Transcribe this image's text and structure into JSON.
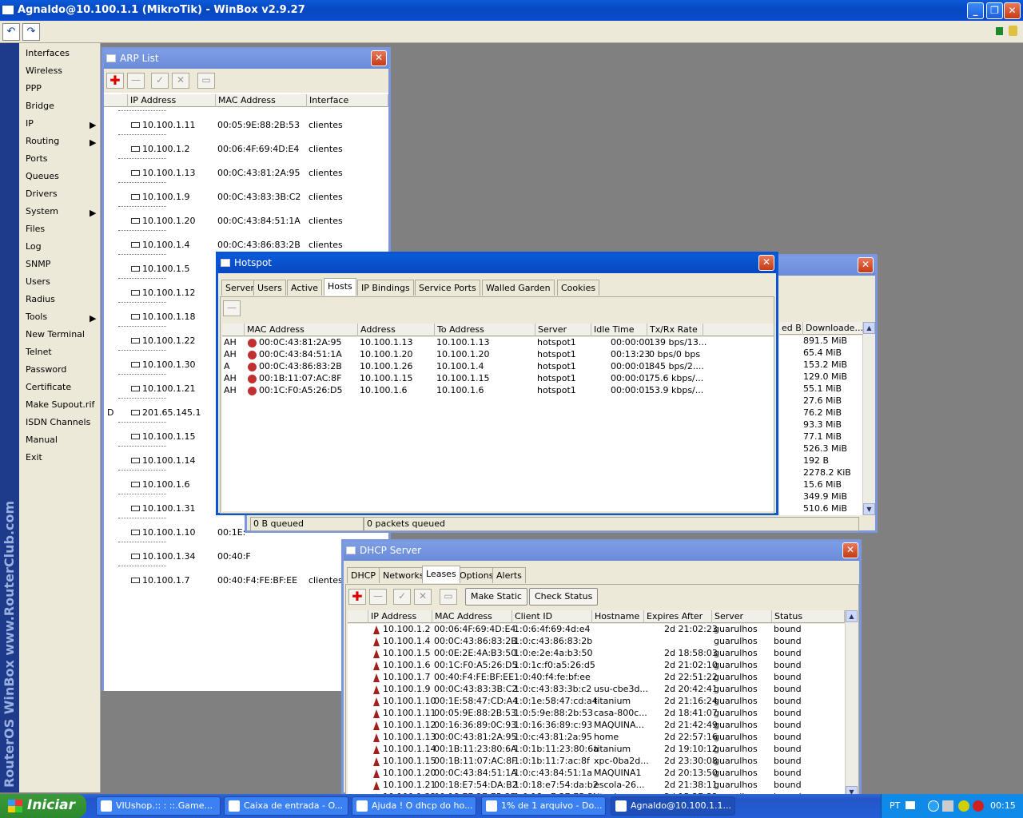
{
  "window_title": "Agnaldo@10.100.1.1 (MikroTik) - WinBox v2.9.27",
  "brand": "RouterOS WinBox  www.RouterClub.com",
  "menu": [
    {
      "label": "Interfaces",
      "sub": false
    },
    {
      "label": "Wireless",
      "sub": false
    },
    {
      "label": "PPP",
      "sub": false
    },
    {
      "label": "Bridge",
      "sub": false
    },
    {
      "label": "IP",
      "sub": true
    },
    {
      "label": "Routing",
      "sub": true
    },
    {
      "label": "Ports",
      "sub": false
    },
    {
      "label": "Queues",
      "sub": false
    },
    {
      "label": "Drivers",
      "sub": false
    },
    {
      "label": "System",
      "sub": true
    },
    {
      "label": "Files",
      "sub": false
    },
    {
      "label": "Log",
      "sub": false
    },
    {
      "label": "SNMP",
      "sub": false
    },
    {
      "label": "Users",
      "sub": false
    },
    {
      "label": "Radius",
      "sub": false
    },
    {
      "label": "Tools",
      "sub": true
    },
    {
      "label": "New Terminal",
      "sub": false
    },
    {
      "label": "Telnet",
      "sub": false
    },
    {
      "label": "Password",
      "sub": false
    },
    {
      "label": "Certificate",
      "sub": false
    },
    {
      "label": "Make Supout.rif",
      "sub": false
    },
    {
      "label": "ISDN Channels",
      "sub": false
    },
    {
      "label": "Manual",
      "sub": false
    },
    {
      "label": "Exit",
      "sub": false
    }
  ],
  "arp": {
    "title": "ARP List",
    "columns": [
      "IP Address",
      "MAC Address",
      "Interface"
    ],
    "rows": [
      {
        "flag": "",
        "ip": "10.100.1.11",
        "mac": "00:05:9E:88:2B:53",
        "iface": "clientes"
      },
      {
        "flag": "",
        "ip": "10.100.1.2",
        "mac": "00:06:4F:69:4D:E4",
        "iface": "clientes"
      },
      {
        "flag": "",
        "ip": "10.100.1.13",
        "mac": "00:0C:43:81:2A:95",
        "iface": "clientes"
      },
      {
        "flag": "",
        "ip": "10.100.1.9",
        "mac": "00:0C:43:83:3B:C2",
        "iface": "clientes"
      },
      {
        "flag": "",
        "ip": "10.100.1.20",
        "mac": "00:0C:43:84:51:1A",
        "iface": "clientes"
      },
      {
        "flag": "",
        "ip": "10.100.1.4",
        "mac": "00:0C:43:86:83:2B",
        "iface": "clientes"
      },
      {
        "flag": "",
        "ip": "10.100.1.5",
        "mac": "",
        "iface": ""
      },
      {
        "flag": "",
        "ip": "10.100.1.12",
        "mac": "",
        "iface": ""
      },
      {
        "flag": "",
        "ip": "10.100.1.18",
        "mac": "",
        "iface": ""
      },
      {
        "flag": "",
        "ip": "10.100.1.22",
        "mac": "",
        "iface": ""
      },
      {
        "flag": "",
        "ip": "10.100.1.30",
        "mac": "",
        "iface": ""
      },
      {
        "flag": "",
        "ip": "10.100.1.21",
        "mac": "",
        "iface": ""
      },
      {
        "flag": "D",
        "ip": "201.65.145.1",
        "mac": "",
        "iface": ""
      },
      {
        "flag": "",
        "ip": "10.100.1.15",
        "mac": "",
        "iface": ""
      },
      {
        "flag": "",
        "ip": "10.100.1.14",
        "mac": "",
        "iface": ""
      },
      {
        "flag": "",
        "ip": "10.100.1.6",
        "mac": "",
        "iface": ""
      },
      {
        "flag": "",
        "ip": "10.100.1.31",
        "mac": "",
        "iface": ""
      },
      {
        "flag": "",
        "ip": "10.100.1.10",
        "mac": "00:1E:",
        "iface": ""
      },
      {
        "flag": "",
        "ip": "10.100.1.34",
        "mac": "00:40:F",
        "iface": ""
      },
      {
        "flag": "",
        "ip": "10.100.1.7",
        "mac": "00:40:F4:FE:BF:EE",
        "iface": "clientes"
      }
    ]
  },
  "queue_win": {
    "columns": [
      "ed B...",
      "Downloade..."
    ],
    "values": [
      "891.5 MiB",
      "65.4 MiB",
      "153.2 MiB",
      "129.0 MiB",
      "55.1 MiB",
      "27.6 MiB",
      "76.2 MiB",
      "93.3 MiB",
      "77.1 MiB",
      "526.3 MiB",
      "192 B",
      "2278.2 KiB",
      "15.6 MiB",
      "349.9 MiB",
      "510.6 MiB"
    ],
    "status1": "0 B queued",
    "status2": "0 packets queued"
  },
  "hotspot": {
    "title": "Hotspot",
    "tabs": [
      "Servers",
      "Users",
      "Active",
      "Hosts",
      "IP Bindings",
      "Service Ports",
      "Walled Garden",
      "Cookies"
    ],
    "active_tab": "Hosts",
    "columns": [
      "MAC Address",
      "Address",
      "To Address",
      "Server",
      "Idle Time",
      "Tx/Rx Rate"
    ],
    "rows": [
      {
        "flag": "AH",
        "mac": "00:0C:43:81:2A:95",
        "addr": "10.100.1.13",
        "to": "10.100.1.13",
        "server": "hotspot1",
        "idle": "00:00:00",
        "rate": "139 bps/13..."
      },
      {
        "flag": "AH",
        "mac": "00:0C:43:84:51:1A",
        "addr": "10.100.1.20",
        "to": "10.100.1.20",
        "server": "hotspot1",
        "idle": "00:13:23",
        "rate": "0 bps/0 bps"
      },
      {
        "flag": "A",
        "mac": "00:0C:43:86:83:2B",
        "addr": "10.100.1.26",
        "to": "10.100.1.4",
        "server": "hotspot1",
        "idle": "00:00:01",
        "rate": "845 bps/2...."
      },
      {
        "flag": "AH",
        "mac": "00:1B:11:07:AC:8F",
        "addr": "10.100.1.15",
        "to": "10.100.1.15",
        "server": "hotspot1",
        "idle": "00:00:01",
        "rate": "75.6 kbps/..."
      },
      {
        "flag": "AH",
        "mac": "00:1C:F0:A5:26:D5",
        "addr": "10.100.1.6",
        "to": "10.100.1.6",
        "server": "hotspot1",
        "idle": "00:00:01",
        "rate": "53.9 kbps/..."
      }
    ]
  },
  "dhcp": {
    "title": "DHCP Server",
    "tabs": [
      "DHCP",
      "Networks",
      "Leases",
      "Options",
      "Alerts"
    ],
    "active_tab": "Leases",
    "make_static": "Make Static",
    "check_status": "Check Status",
    "columns": [
      "IP Address",
      "MAC Address",
      "Client ID",
      "Hostname",
      "Expires After",
      "Server",
      "Status"
    ],
    "rows": [
      {
        "ip": "10.100.1.2",
        "mac": "00:06:4F:69:4D:E4",
        "cid": "1:0:6:4f:69:4d:e4",
        "host": "",
        "exp": "2d 21:02:23",
        "server": "guarulhos",
        "status": "bound"
      },
      {
        "ip": "10.100.1.4",
        "mac": "00:0C:43:86:83:2B",
        "cid": "1:0:c:43:86:83:2b",
        "host": "",
        "exp": "",
        "server": "guarulhos",
        "status": "bound"
      },
      {
        "ip": "10.100.1.5",
        "mac": "00:0E:2E:4A:B3:50",
        "cid": "1:0:e:2e:4a:b3:50",
        "host": "",
        "exp": "2d 18:58:03",
        "server": "guarulhos",
        "status": "bound"
      },
      {
        "ip": "10.100.1.6",
        "mac": "00:1C:F0:A5:26:D5",
        "cid": "1:0:1c:f0:a5:26:d5",
        "host": "",
        "exp": "2d 21:02:10",
        "server": "guarulhos",
        "status": "bound"
      },
      {
        "ip": "10.100.1.7",
        "mac": "00:40:F4:FE:BF:EE",
        "cid": "1:0:40:f4:fe:bf:ee",
        "host": "",
        "exp": "2d 22:51:22",
        "server": "guarulhos",
        "status": "bound"
      },
      {
        "ip": "10.100.1.9",
        "mac": "00:0C:43:83:3B:C2",
        "cid": "1:0:c:43:83:3b:c2",
        "host": "usu-cbe3d...",
        "exp": "2d 20:42:41",
        "server": "guarulhos",
        "status": "bound"
      },
      {
        "ip": "10.100.1.10",
        "mac": "00:1E:58:47:CD:A4",
        "cid": "1:0:1e:58:47:cd:a4",
        "host": "titanium",
        "exp": "2d 21:16:24",
        "server": "guarulhos",
        "status": "bound"
      },
      {
        "ip": "10.100.1.11",
        "mac": "00:05:9E:88:2B:53",
        "cid": "1:0:5:9e:88:2b:53",
        "host": "casa-800c...",
        "exp": "2d 18:41:07",
        "server": "guarulhos",
        "status": "bound"
      },
      {
        "ip": "10.100.1.12",
        "mac": "00:16:36:89:0C:93",
        "cid": "1:0:16:36:89:c:93",
        "host": "MAQUINA...",
        "exp": "2d 21:42:49",
        "server": "guarulhos",
        "status": "bound"
      },
      {
        "ip": "10.100.1.13",
        "mac": "00:0C:43:81:2A:95",
        "cid": "1:0:c:43:81:2a:95",
        "host": "home",
        "exp": "2d 22:57:16",
        "server": "guarulhos",
        "status": "bound"
      },
      {
        "ip": "10.100.1.14",
        "mac": "00:1B:11:23:80:6A",
        "cid": "1:0:1b:11:23:80:6a",
        "host": "titanium",
        "exp": "2d 19:10:12",
        "server": "guarulhos",
        "status": "bound"
      },
      {
        "ip": "10.100.1.15",
        "mac": "00:1B:11:07:AC:8F",
        "cid": "1:0:1b:11:7:ac:8f",
        "host": "xpc-0ba2d...",
        "exp": "2d 23:30:08",
        "server": "guarulhos",
        "status": "bound"
      },
      {
        "ip": "10.100.1.20",
        "mac": "00:0C:43:84:51:1A",
        "cid": "1:0:c:43:84:51:1a",
        "host": "MAQUINA1",
        "exp": "2d 20:13:50",
        "server": "guarulhos",
        "status": "bound"
      },
      {
        "ip": "10.100.1.21",
        "mac": "00:18:E7:54:DA:B2",
        "cid": "1:0:18:e7:54:da:b2",
        "host": "escola-26...",
        "exp": "2d 21:38:11",
        "server": "guarulhos",
        "status": "bound"
      },
      {
        "ip": "10.100.1.22",
        "mac": "00:18:E7:27:75:3B",
        "cid": "1:0:18:e7:27:75:3b",
        "host": "titanium",
        "exp": "2d 15:27:32",
        "server": "guarulhos",
        "status": "bound"
      }
    ]
  },
  "taskbar": {
    "start": "Iniciar",
    "items": [
      "VIUshop.:: : ::.Game...",
      "Caixa de entrada - O...",
      "Ajuda ! O dhcp do ho...",
      "1% de 1 arquivo - Do...",
      "Agnaldo@10.100.1.1..."
    ],
    "lang": "PT",
    "clock": "00:15"
  }
}
